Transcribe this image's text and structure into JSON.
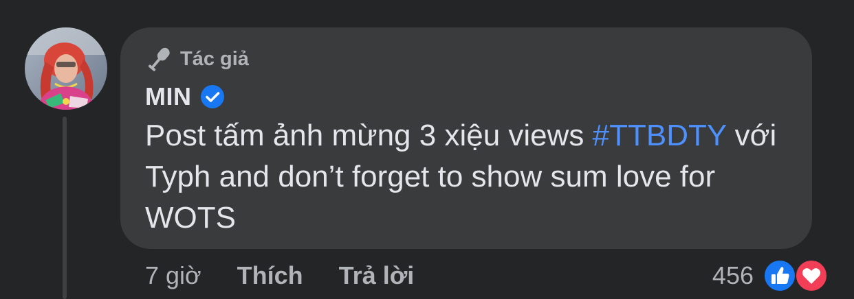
{
  "comment": {
    "badge_icon": "microphone-icon",
    "badge_label": "Tác giả",
    "author_name": "MIN",
    "verified_icon": "verified-checkmark-icon",
    "text_before_hashtag": "Post tấm ảnh mừng 3 xiệu views ",
    "hashtag": "#TTBDTY",
    "text_after_hashtag": " với Typh and don’t forget to show sum love for WOTS"
  },
  "actions": {
    "time": "7 giờ",
    "like_label": "Thích",
    "reply_label": "Trả lời"
  },
  "reactions": {
    "count": "456",
    "icons": [
      "like-icon",
      "love-icon"
    ]
  },
  "colors": {
    "background": "#242526",
    "bubble": "#3a3b3c",
    "primary_text": "#e4e6eb",
    "secondary_text": "#b0b3b8",
    "hashtag": "#4d90fe",
    "verified_blue": "#1877f2",
    "love_red": "#f33e58"
  }
}
